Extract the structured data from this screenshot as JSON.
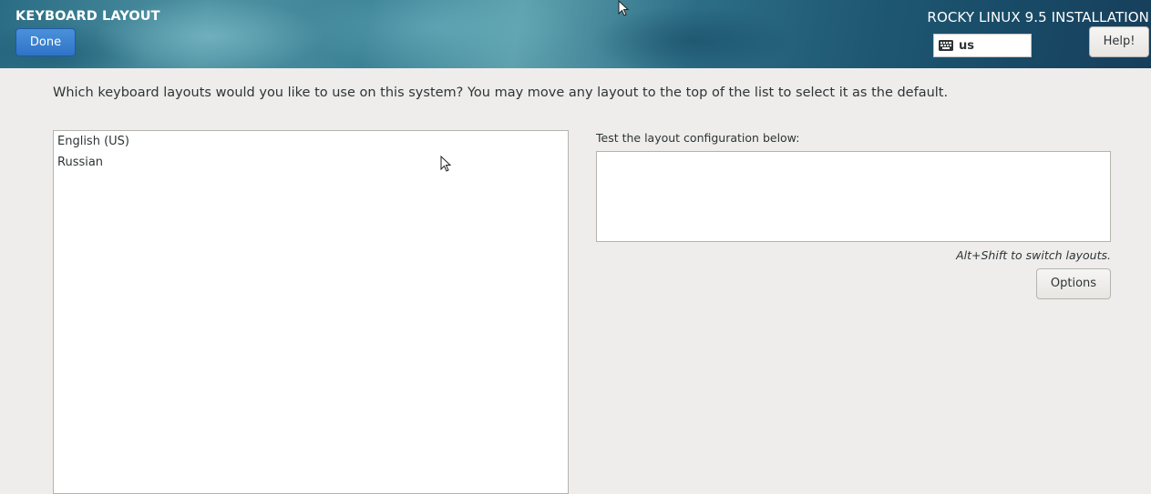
{
  "header": {
    "title": "KEYBOARD LAYOUT",
    "done_label": "Done",
    "product": "ROCKY LINUX 9.5 INSTALLATION",
    "keyboard_indicator": "us",
    "keyboard_icon": "keyboard-icon",
    "help_label": "Help!"
  },
  "main": {
    "instruction": "Which keyboard layouts would you like to use on this system?  You may move any layout to the top of the list to select it as the default.",
    "layouts": [
      {
        "label": "English (US)"
      },
      {
        "label": "Russian"
      }
    ],
    "test_label": "Test the layout configuration below:",
    "test_value": "",
    "switch_hint": "Alt+Shift to switch layouts.",
    "options_label": "Options"
  },
  "colors": {
    "accent": "#3584e4",
    "background": "#eeedec",
    "header_dark": "#173f5c"
  }
}
